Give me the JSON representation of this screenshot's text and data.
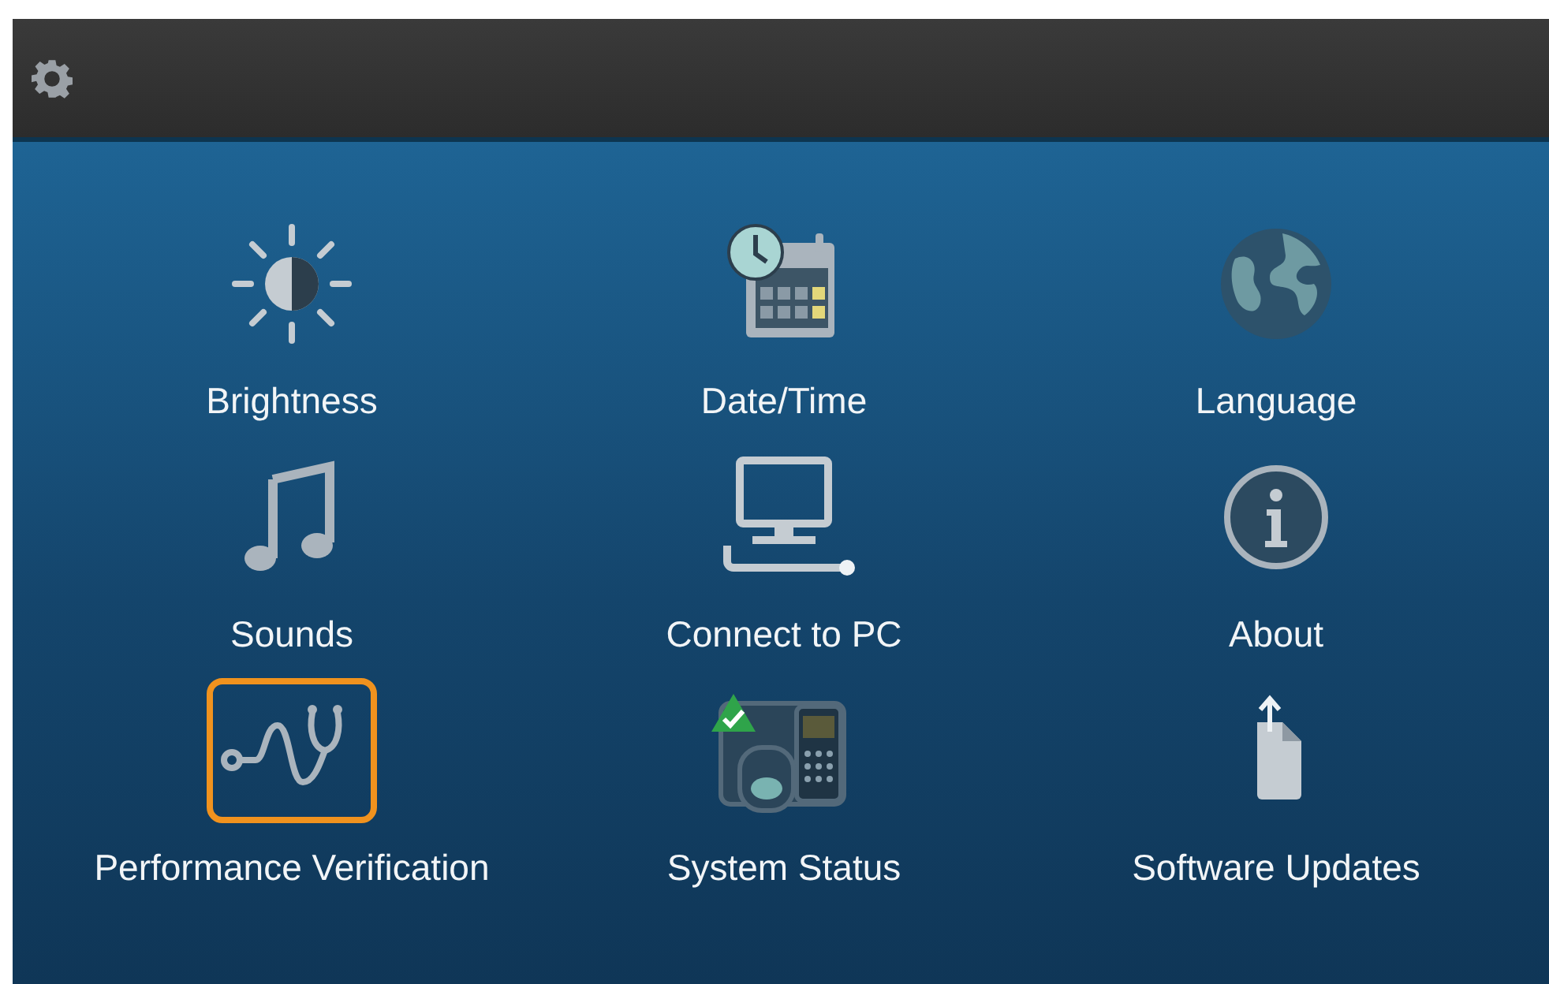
{
  "items": [
    {
      "kind": "brightness",
      "label": "Brightness",
      "selected": false
    },
    {
      "kind": "datetime",
      "label": "Date/Time",
      "selected": false
    },
    {
      "kind": "globe",
      "label": "Language",
      "selected": false
    },
    {
      "kind": "music",
      "label": "Sounds",
      "selected": false
    },
    {
      "kind": "computer",
      "label": "Connect to PC",
      "selected": false
    },
    {
      "kind": "info",
      "label": "About",
      "selected": false
    },
    {
      "kind": "stethoscope",
      "label": "Performance Verification",
      "selected": true
    },
    {
      "kind": "device",
      "label": "System Status",
      "selected": false
    },
    {
      "kind": "upload",
      "label": "Software Updates",
      "selected": false
    }
  ]
}
